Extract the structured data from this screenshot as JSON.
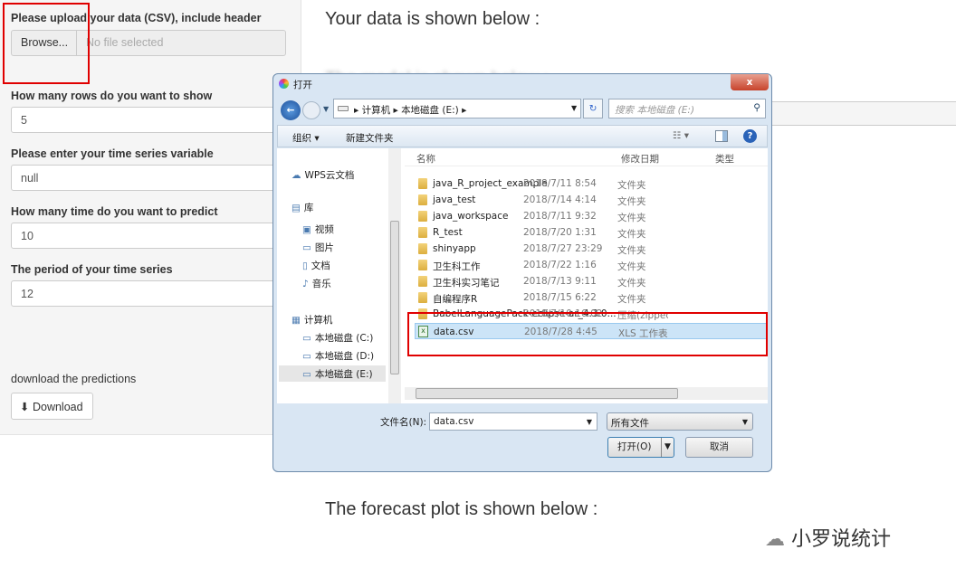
{
  "sidebar": {
    "upload_label": "Please upload your data (CSV), include header",
    "browse_label": "Browse...",
    "file_placeholder": "No file selected",
    "rows_label": "How many rows do you want to show",
    "rows_value": "5",
    "ts_label": "Please enter your time series variable",
    "ts_value": "null",
    "predict_label": "How many time do you want to predict",
    "predict_value": "10",
    "period_label": "The period of your time series",
    "period_value": "12",
    "download_text": "download the predictions",
    "download_button": "Download"
  },
  "main": {
    "data_heading": "Your data is shown below :",
    "model_heading": "The model is shown below :",
    "forecast_heading": "The forecast plot is shown below :"
  },
  "dialog": {
    "title": "打开",
    "breadcrumb": [
      "计算机",
      "本地磁盘 (E:)"
    ],
    "search_placeholder": "搜索 本地磁盘 (E:)",
    "organize": "组织 ▾",
    "new_folder": "新建文件夹",
    "columns": [
      "名称",
      "修改日期",
      "类型"
    ],
    "nav": [
      {
        "label": "WPS云文档",
        "icon": "cloud-icon"
      },
      {
        "label": "库",
        "icon": "library-icon"
      },
      {
        "label": "视频",
        "icon": "video-icon"
      },
      {
        "label": "图片",
        "icon": "picture-icon"
      },
      {
        "label": "文档",
        "icon": "document-icon"
      },
      {
        "label": "音乐",
        "icon": "music-icon"
      },
      {
        "label": "计算机",
        "icon": "computer-icon"
      },
      {
        "label": "本地磁盘 (C:)",
        "icon": "drive-icon"
      },
      {
        "label": "本地磁盘 (D:)",
        "icon": "drive-icon"
      },
      {
        "label": "本地磁盘 (E:)",
        "icon": "drive-icon"
      }
    ],
    "files": [
      {
        "name": "java_R_project_example",
        "date": "2018/7/11 8:54",
        "type": "文件夹"
      },
      {
        "name": "java_test",
        "date": "2018/7/14 4:14",
        "type": "文件夹"
      },
      {
        "name": "java_workspace",
        "date": "2018/7/11 9:32",
        "type": "文件夹"
      },
      {
        "name": "R_test",
        "date": "2018/7/20 1:31",
        "type": "文件夹"
      },
      {
        "name": "shinyapp",
        "date": "2018/7/27 23:29",
        "type": "文件夹"
      },
      {
        "name": "卫生科工作",
        "date": "2018/7/22 1:16",
        "type": "文件夹"
      },
      {
        "name": "卫生科实习笔记",
        "date": "2018/7/13 9:11",
        "type": "文件夹"
      },
      {
        "name": "自编程序R",
        "date": "2018/7/15 6:22",
        "type": "文件夹"
      },
      {
        "name": "BabelLanguagePack-eclipse-ar_4.3.0...",
        "date": "2018/7/10 16:02",
        "type": "压缩(zipped"
      },
      {
        "name": "data.csv",
        "date": "2018/7/28 4:45",
        "type": "XLS 工作表"
      }
    ],
    "filename_label": "文件名(N):",
    "filename_value": "data.csv",
    "filter": "所有文件",
    "open": "打开(O)",
    "cancel": "取消"
  },
  "watermark": "小罗说统计",
  "colors": {
    "highlight": "#e00000",
    "selection": "#cce4f7"
  }
}
